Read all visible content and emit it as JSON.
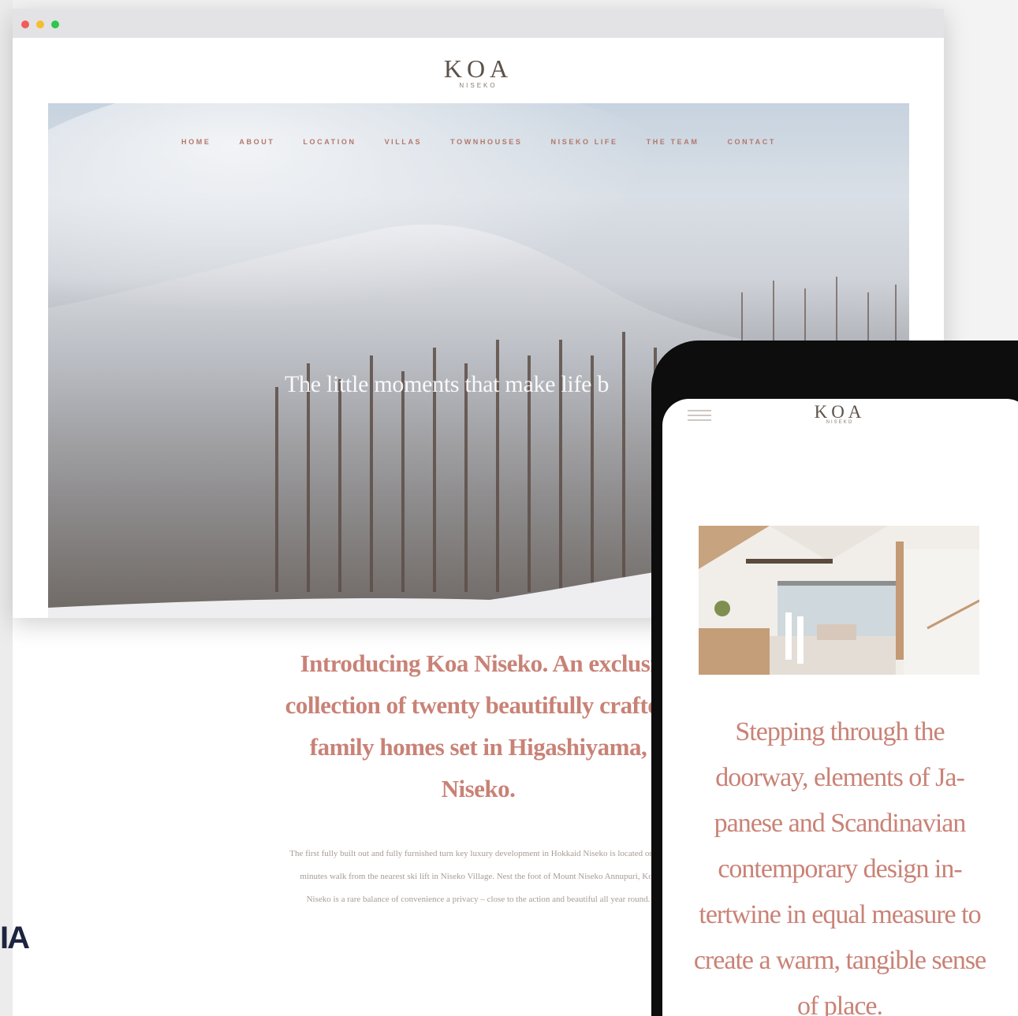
{
  "desktop": {
    "logo": {
      "name": "KOA",
      "sub": "NISEKO"
    },
    "nav": [
      "HOME",
      "ABOUT",
      "LOCATION",
      "VILLAS",
      "TOWNHOUSES",
      "NISEKO LIFE",
      "THE TEAM",
      "CONTACT"
    ],
    "hero_tagline": "The little moments that make life b",
    "intro_heading": "Introducing Koa Niseko. An exclusi collection of twenty beautifully crafted family homes set in Higashiyama, Niseko.",
    "intro_body": "The first fully built out and fully furnished turn key luxury development in Hokkaid Niseko is located only 8 minutes walk from the nearest ski lift in Niseko Village. Nest the foot of Mount Niseko Annupuri, Koa Niseko is a rare balance of convenience a privacy – close to the action and beautiful all year round."
  },
  "mobile": {
    "logo": {
      "name": "KOA",
      "sub": "NISEKO"
    },
    "menu_icon": "hamburger-menu-icon",
    "text": "Stepping through the doorway, elements of Ja-panese and Scandinavian contemporary design in-tertwine in equal measure to create a warm, tangible sense of place."
  },
  "colors": {
    "accent": "#c98276",
    "nav": "#b2776a",
    "logo": "#5c524a"
  },
  "edge_text": "IA"
}
